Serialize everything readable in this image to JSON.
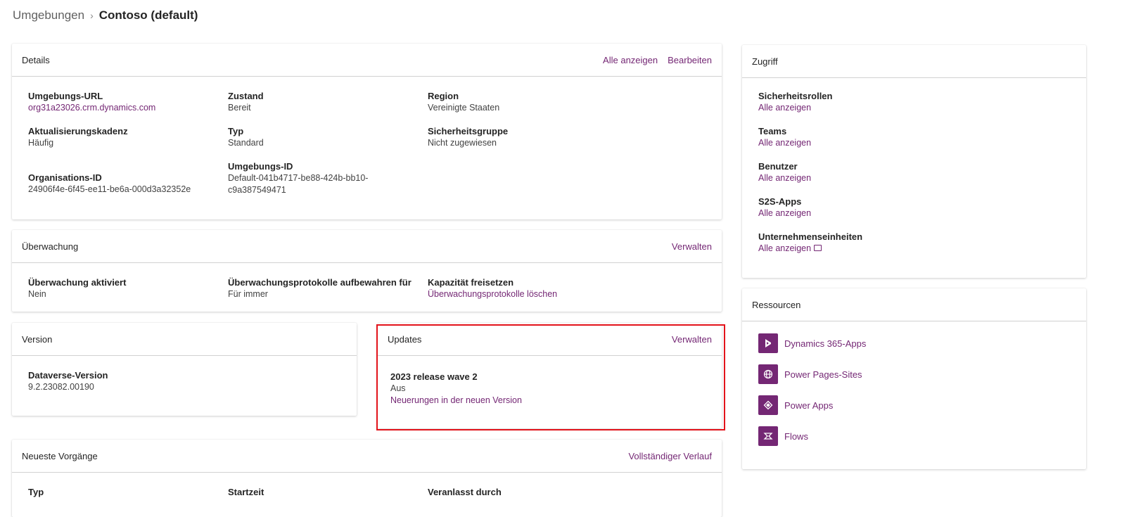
{
  "breadcrumb": {
    "parent": "Umgebungen",
    "separator": "›",
    "current": "Contoso (default)"
  },
  "details": {
    "title": "Details",
    "actions": {
      "show_all": "Alle anzeigen",
      "edit": "Bearbeiten"
    },
    "fields": {
      "env_url": {
        "label": "Umgebungs-URL",
        "value": "org31a23026.crm.dynamics.com"
      },
      "state": {
        "label": "Zustand",
        "value": "Bereit"
      },
      "region": {
        "label": "Region",
        "value": "Vereinigte Staaten"
      },
      "cadence": {
        "label": "Aktualisierungskadenz",
        "value": "Häufig"
      },
      "type": {
        "label": "Typ",
        "value": "Standard"
      },
      "security_group": {
        "label": "Sicherheitsgruppe",
        "value": "Nicht zugewiesen"
      },
      "org_id": {
        "label": "Organisations-ID",
        "value": "24906f4e-6f45-ee11-be6a-000d3a32352e"
      },
      "env_id": {
        "label": "Umgebungs-ID",
        "value_line1": "Default-041b4717-be88-424b-bb10-",
        "value_line2": "c9a387549471"
      }
    }
  },
  "audit": {
    "title": "Überwachung",
    "action": "Verwalten",
    "fields": {
      "enabled": {
        "label": "Überwachung aktiviert",
        "value": "Nein"
      },
      "retention": {
        "label": "Überwachungsprotokolle aufbewahren für",
        "value": "Für immer"
      },
      "capacity": {
        "label": "Kapazität freisetzen",
        "value": "Überwachungsprotokolle löschen"
      }
    }
  },
  "version": {
    "title": "Version",
    "label": "Dataverse-Version",
    "value": "9.2.23082.00190"
  },
  "updates": {
    "title": "Updates",
    "action": "Verwalten",
    "wave": "2023 release wave 2",
    "status": "Aus",
    "link": "Neuerungen in der neuen Version"
  },
  "recent": {
    "title": "Neueste Vorgänge",
    "action": "Vollständiger Verlauf",
    "columns": [
      "Typ",
      "Startzeit",
      "Veranlasst durch"
    ]
  },
  "access": {
    "title": "Zugriff",
    "items": [
      {
        "label": "Sicherheitsrollen",
        "link": "Alle anzeigen"
      },
      {
        "label": "Teams",
        "link": "Alle anzeigen"
      },
      {
        "label": "Benutzer",
        "link": "Alle anzeigen"
      },
      {
        "label": "S2S-Apps",
        "link": "Alle anzeigen"
      },
      {
        "label": "Unternehmenseinheiten",
        "link": "Alle anzeigen"
      }
    ]
  },
  "resources": {
    "title": "Ressourcen",
    "items": [
      {
        "label": "Dynamics 365-Apps",
        "icon": "dynamics-icon"
      },
      {
        "label": "Power Pages-Sites",
        "icon": "globe-icon"
      },
      {
        "label": "Power Apps",
        "icon": "power-apps-icon"
      },
      {
        "label": "Flows",
        "icon": "flows-icon"
      }
    ]
  },
  "colors": {
    "accent": "#742774",
    "highlight": "#e3131b"
  }
}
